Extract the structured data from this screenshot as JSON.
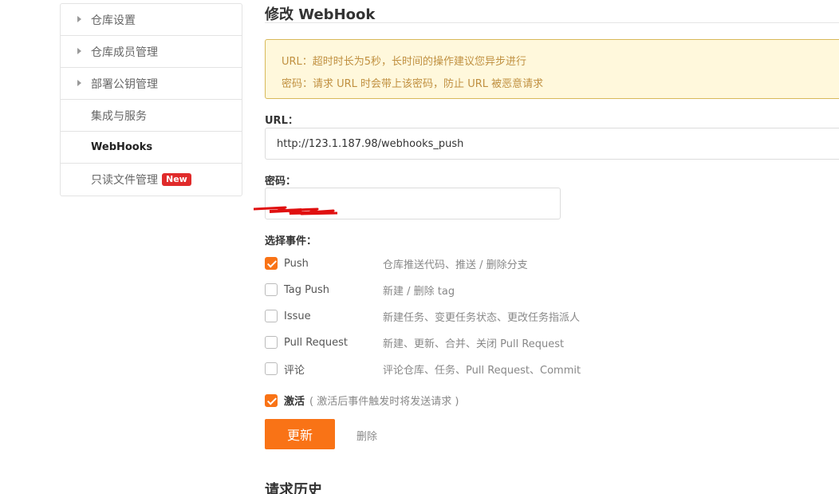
{
  "sidebar": {
    "items": [
      {
        "label": "仓库设置"
      },
      {
        "label": "仓库成员管理"
      },
      {
        "label": "部署公钥管理"
      },
      {
        "label": "集成与服务"
      },
      {
        "label": "WebHooks"
      },
      {
        "label": "只读文件管理",
        "badge": "New"
      }
    ]
  },
  "main": {
    "title": "修改 WebHook",
    "notice": {
      "line1": "URL：超时时长为5秒，长时间的操作建议您异步进行",
      "line2": "密码：请求 URL 时会带上该密码，防止 URL 被恶意请求"
    },
    "url_label": "URL：",
    "url_value": "http://123.1.187.98/webhooks_push",
    "password_label": "密码：",
    "events_label": "选择事件：",
    "events": [
      {
        "name": "Push",
        "desc": "仓库推送代码、推送 / 删除分支",
        "checked": true
      },
      {
        "name": "Tag Push",
        "desc": "新建 / 删除 tag",
        "checked": false
      },
      {
        "name": "Issue",
        "desc": "新建任务、变更任务状态、更改任务指派人",
        "checked": false
      },
      {
        "name": "Pull Request",
        "desc": "新建、更新、合并、关闭 Pull Request",
        "checked": false
      },
      {
        "name": "评论",
        "desc": "评论仓库、任务、Pull Request、Commit",
        "checked": false
      }
    ],
    "activate_label": "激活",
    "activate_note": "( 激活后事件触发时将发送请求 )",
    "update_button": "更新",
    "delete_link": "删除",
    "history_title": "请求历史"
  },
  "colors": {
    "accent": "#f97316",
    "notice_bg": "#fff8dc",
    "notice_text": "#c09040",
    "badge": "#e02b2b"
  }
}
